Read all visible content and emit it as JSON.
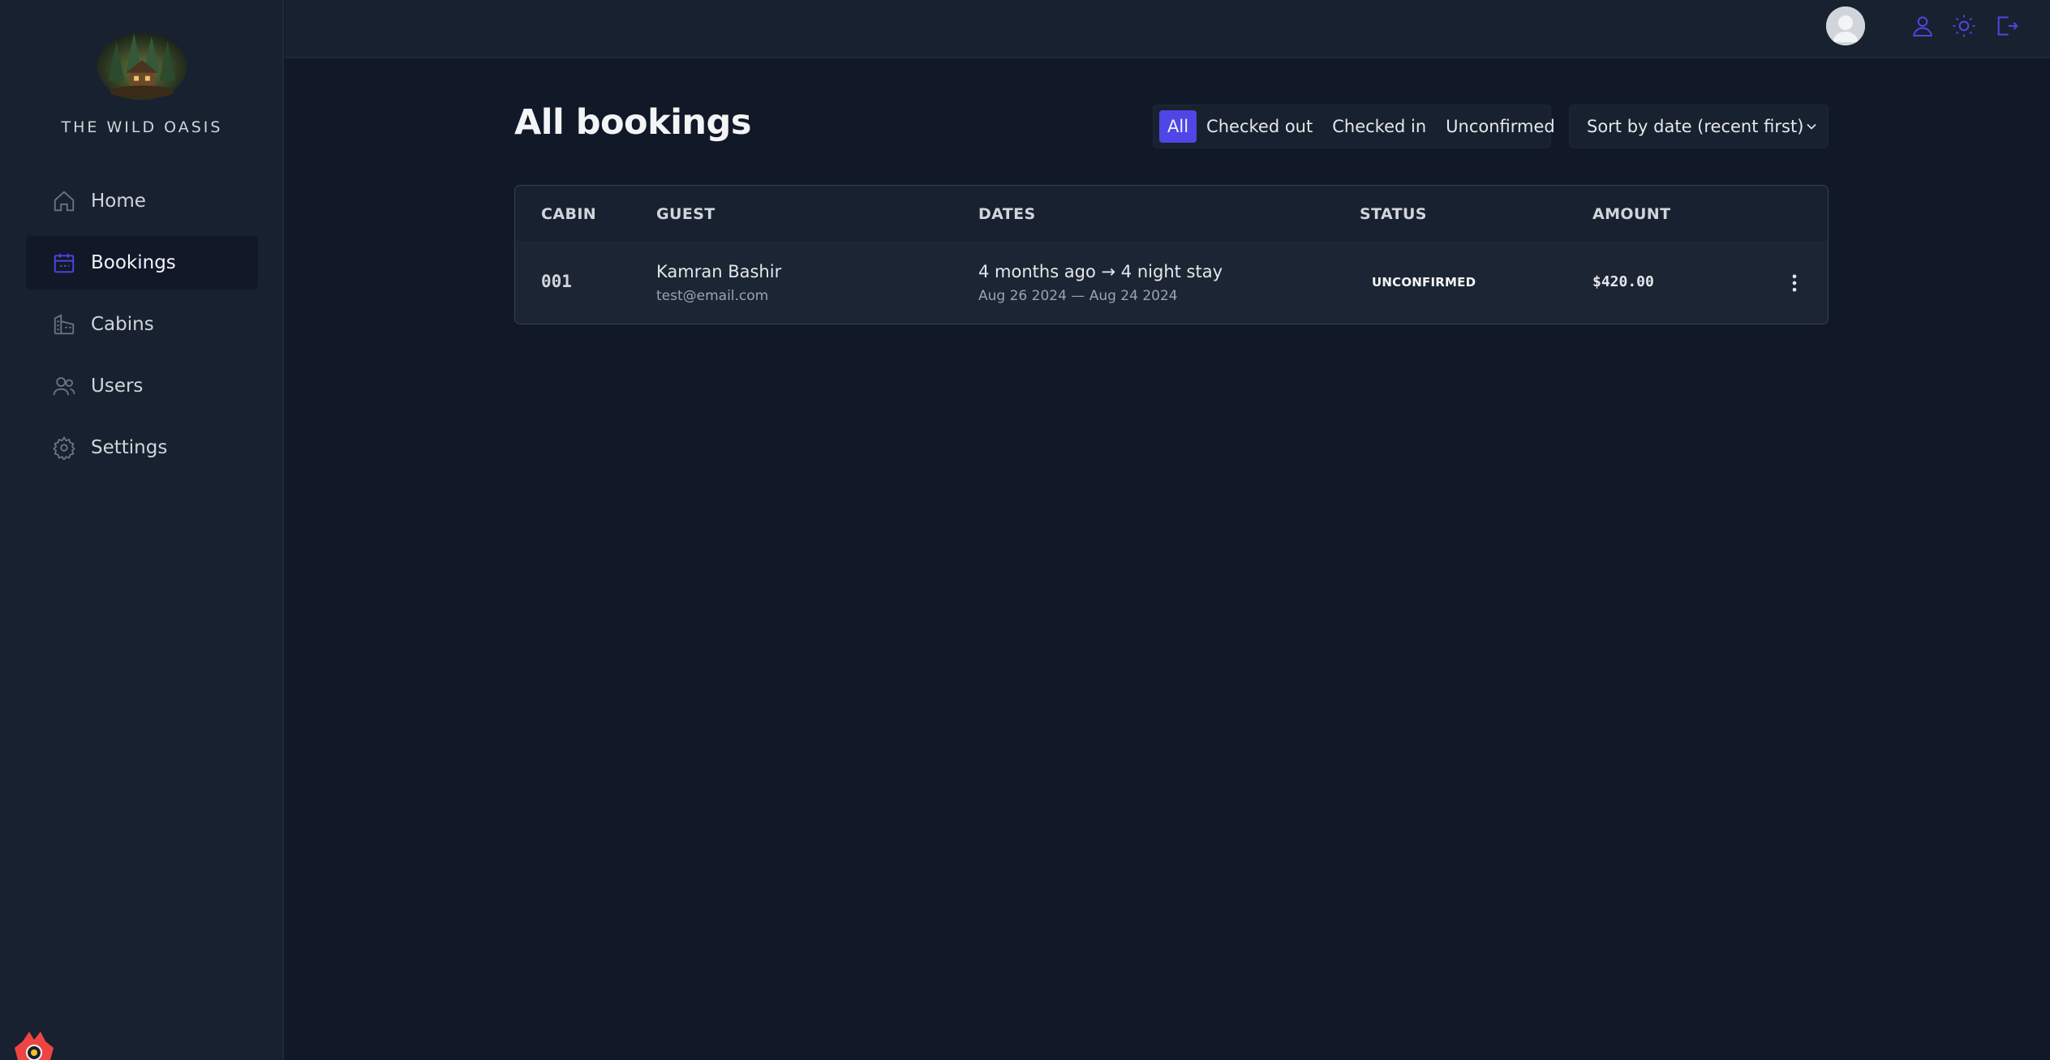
{
  "sidebar": {
    "logo_text": "THE WILD OASIS",
    "items": [
      {
        "label": "Home",
        "icon": "home-icon"
      },
      {
        "label": "Bookings",
        "icon": "calendar-icon",
        "active": true
      },
      {
        "label": "Cabins",
        "icon": "buildings-icon"
      },
      {
        "label": "Users",
        "icon": "users-icon"
      },
      {
        "label": "Settings",
        "icon": "gear-icon"
      }
    ]
  },
  "header": {
    "icons": [
      "avatar",
      "user-icon",
      "sun-icon",
      "logout-icon"
    ]
  },
  "main": {
    "title": "All bookings",
    "filters": [
      {
        "label": "All",
        "active": true
      },
      {
        "label": "Checked out"
      },
      {
        "label": "Checked in"
      },
      {
        "label": "Unconfirmed"
      }
    ],
    "sort": {
      "selected": "Sort by date (recent first)"
    },
    "table": {
      "headers": [
        "CABIN",
        "GUEST",
        "DATES",
        "STATUS",
        "AMOUNT"
      ],
      "rows": [
        {
          "cabin": "001",
          "guest_name": "Kamran Bashir",
          "guest_email": "test@email.com",
          "dates_main": "4 months ago → 4 night stay",
          "dates_sub": "Aug 26 2024 — Aug 24 2024",
          "status": "UNCONFIRMED",
          "amount": "$420.00"
        }
      ]
    }
  },
  "colors": {
    "accent": "#4f46e5",
    "sidebar_bg": "#18212f",
    "page_bg": "#111827"
  }
}
